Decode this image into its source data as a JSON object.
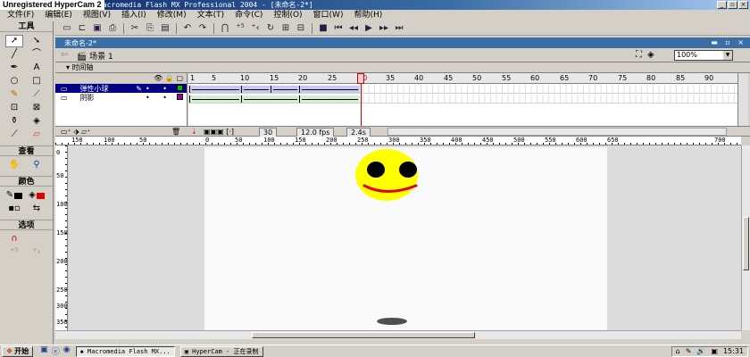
{
  "title_bar": {
    "watermark": "Unregistered HyperCam 2",
    "title": "Macromedia Flash MX Professional 2004 - [未命名-2*]",
    "window_controls": [
      "_",
      "▫",
      "×"
    ]
  },
  "menu": [
    "文件(F)",
    "编辑(E)",
    "视图(V)",
    "插入(I)",
    "修改(M)",
    "文本(T)",
    "命令(C)",
    "控制(O)",
    "窗口(W)",
    "帮助(H)"
  ],
  "tools_panel": {
    "header": "工具",
    "view_label": "查看",
    "colors_label": "颜色",
    "options_label": "选项"
  },
  "document": {
    "tab": "未命名-2*",
    "scene": "场景 1",
    "zoom": "100%"
  },
  "timeline": {
    "header": "时间轴",
    "frame_numbers": [
      "1",
      "5",
      "10",
      "15",
      "20",
      "25",
      "30",
      "35",
      "40",
      "45",
      "50",
      "55",
      "60",
      "65",
      "70",
      "75",
      "80",
      "85",
      "90"
    ],
    "layers": [
      {
        "name": "弹性小球",
        "selected": true,
        "color": "#00c000"
      },
      {
        "name": "阴影",
        "selected": false,
        "color": "#a000a0"
      }
    ],
    "current_frame": "30",
    "fps": "12.0 fps",
    "time": "2.4s"
  },
  "ruler": {
    "h_labels": [
      "150",
      "100",
      "50",
      "0",
      "50",
      "100",
      "150",
      "200",
      "250",
      "300",
      "350",
      "400",
      "450",
      "500",
      "550",
      "600",
      "650",
      "700"
    ],
    "v_labels": [
      "0",
      "50",
      "100",
      "150",
      "200",
      "250",
      "300",
      "350"
    ]
  },
  "stage_colors": {
    "face": "#ffff00",
    "eyes": "#000000",
    "smile": "#e00000"
  },
  "taskbar": {
    "start": "开始",
    "tasks": [
      "Macromedia Flash MX...",
      "HyperCam - 正在录制"
    ],
    "clock": "15:31"
  }
}
